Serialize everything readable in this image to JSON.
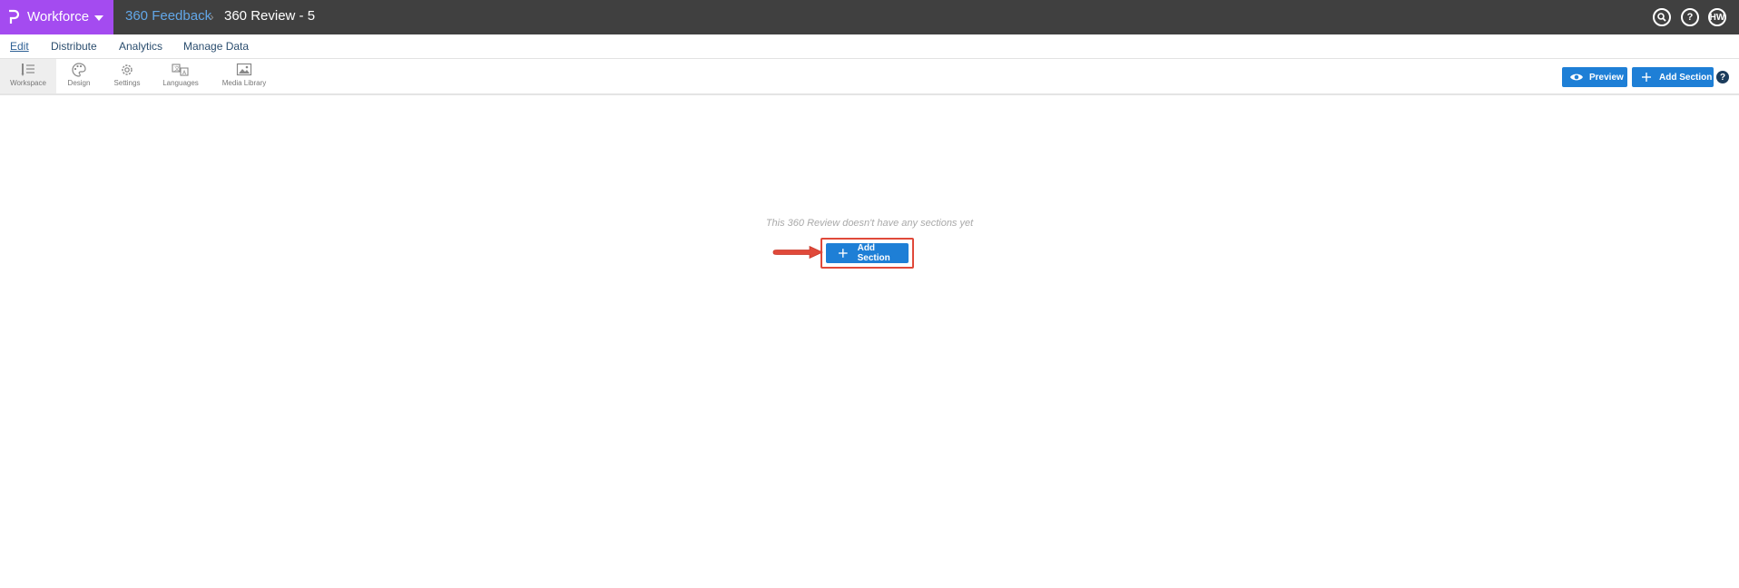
{
  "header": {
    "app_name": "Workforce",
    "breadcrumb_parent": "360 Feedback",
    "breadcrumb_separator": "›",
    "breadcrumb_current": "360 Review - 5",
    "avatar_initials": "HW",
    "search_icon": "search-icon",
    "help_icon": "help-icon",
    "brand_color": "#a44bf0"
  },
  "menu": {
    "items": [
      {
        "label": "Edit",
        "active": true
      },
      {
        "label": "Distribute",
        "active": false
      },
      {
        "label": "Analytics",
        "active": false
      },
      {
        "label": "Manage Data",
        "active": false
      }
    ]
  },
  "toolbar": {
    "tools": [
      {
        "label": "Workspace",
        "icon": "workspace-icon",
        "active": true
      },
      {
        "label": "Design",
        "icon": "palette-icon",
        "active": false
      },
      {
        "label": "Settings",
        "icon": "gear-icon",
        "active": false
      },
      {
        "label": "Languages",
        "icon": "translate-icon",
        "active": false
      },
      {
        "label": "Media Library",
        "icon": "image-icon",
        "active": false
      }
    ],
    "preview_label": "Preview",
    "add_section_label": "Add Section",
    "help_symbol": "?",
    "accent_color": "#1e7fd6"
  },
  "main": {
    "empty_message": "This 360 Review doesn't have any sections yet",
    "add_section_label": "Add Section",
    "highlight_color": "#e0493a"
  }
}
